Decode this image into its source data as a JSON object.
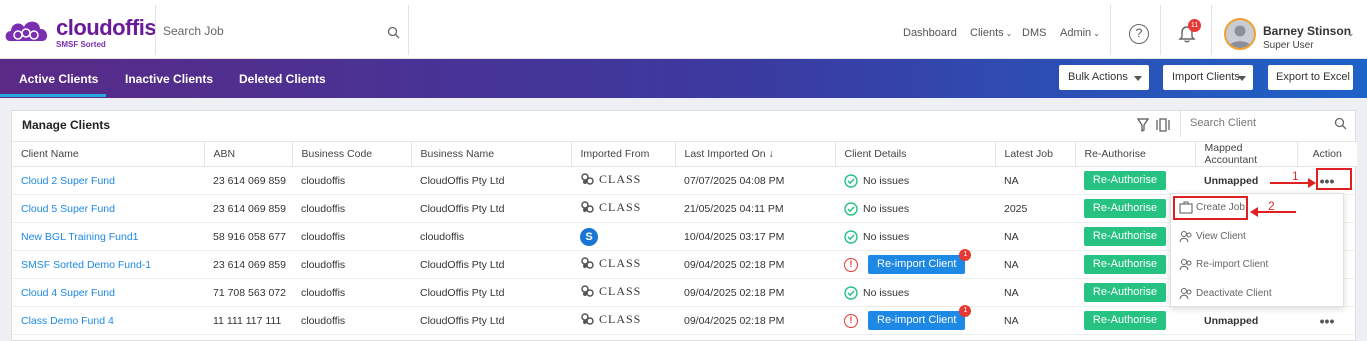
{
  "brand": {
    "name": "cloudoffis",
    "tagline": "SMSF Sorted",
    "color": "#6a1b9a"
  },
  "search_job": {
    "placeholder": "Search Job"
  },
  "nav": {
    "dashboard": "Dashboard",
    "clients": "Clients",
    "dms": "DMS",
    "admin": "Admin"
  },
  "notifications": {
    "count": "11"
  },
  "user": {
    "name": "Barney Stinson",
    "role": "Super User"
  },
  "tabs": [
    "Active Clients",
    "Inactive Clients",
    "Deleted Clients"
  ],
  "actions": {
    "bulk": "Bulk Actions",
    "import": "Import Clients",
    "export": "Export to Excel"
  },
  "card": {
    "title": "Manage Clients",
    "search_placeholder": "Search Client"
  },
  "columns": [
    "Client Name",
    "ABN",
    "Business Code",
    "Business Name",
    "Imported From",
    "Last Imported On",
    "Client Details",
    "Latest Job",
    "Re-Authorise",
    "Mapped Accountant",
    "Action"
  ],
  "rows": [
    {
      "name": "Cloud 2 Super Fund",
      "abn": "23 614 069 859",
      "code": "cloudoffis",
      "business": "CloudOffis Pty Ltd",
      "source": "CLASS",
      "imported": "07/07/2025 04:08 PM",
      "details": "No issues",
      "latest_job": "NA",
      "reauth": "Re-Authorise",
      "accountant": "Unmapped"
    },
    {
      "name": "Cloud 5 Super Fund",
      "abn": "23 614 069 859",
      "code": "cloudoffis",
      "business": "CloudOffis Pty Ltd",
      "source": "CLASS",
      "imported": "21/05/2025 04:11 PM",
      "details": "No issues",
      "latest_job": "2025",
      "reauth": "Re-Authorise",
      "accountant": ""
    },
    {
      "name": "New BGL Training Fund1",
      "abn": "58 916 058 677",
      "code": "cloudoffis",
      "business": "cloudoffis",
      "source": "BGL",
      "imported": "10/04/2025 03:17 PM",
      "details": "No issues",
      "latest_job": "NA",
      "reauth": "Re-Authorise",
      "accountant": ""
    },
    {
      "name": "SMSF Sorted Demo Fund-1",
      "abn": "23 614 069 859",
      "code": "cloudoffis",
      "business": "CloudOffis Pty Ltd",
      "source": "CLASS",
      "imported": "09/04/2025 02:18 PM",
      "details": "Re-import Client",
      "details_badge": "1",
      "latest_job": "NA",
      "reauth": "Re-Authorise",
      "accountant": ""
    },
    {
      "name": "Cloud 4 Super Fund",
      "abn": "71 708 563 072",
      "code": "cloudoffis",
      "business": "CloudOffis Pty Ltd",
      "source": "CLASS",
      "imported": "09/04/2025 02:18 PM",
      "details": "No issues",
      "latest_job": "NA",
      "reauth": "Re-Authorise",
      "accountant": ""
    },
    {
      "name": "Class Demo Fund 4",
      "abn": "11 111 117 111",
      "code": "cloudoffis",
      "business": "CloudOffis Pty Ltd",
      "source": "CLASS",
      "imported": "09/04/2025 02:18 PM",
      "details": "Re-import Client",
      "details_badge": "1",
      "latest_job": "NA",
      "reauth": "Re-Authorise",
      "accountant": "Unmapped"
    }
  ],
  "action_menu": [
    "Create Job",
    "View Client",
    "Re-import Client",
    "Deactivate Client"
  ],
  "annotations": {
    "step1": "1",
    "step2": "2"
  },
  "colors": {
    "accent": "#1e88e5",
    "success": "#26c281",
    "danger": "#e53935",
    "annotation": "#e02020"
  }
}
